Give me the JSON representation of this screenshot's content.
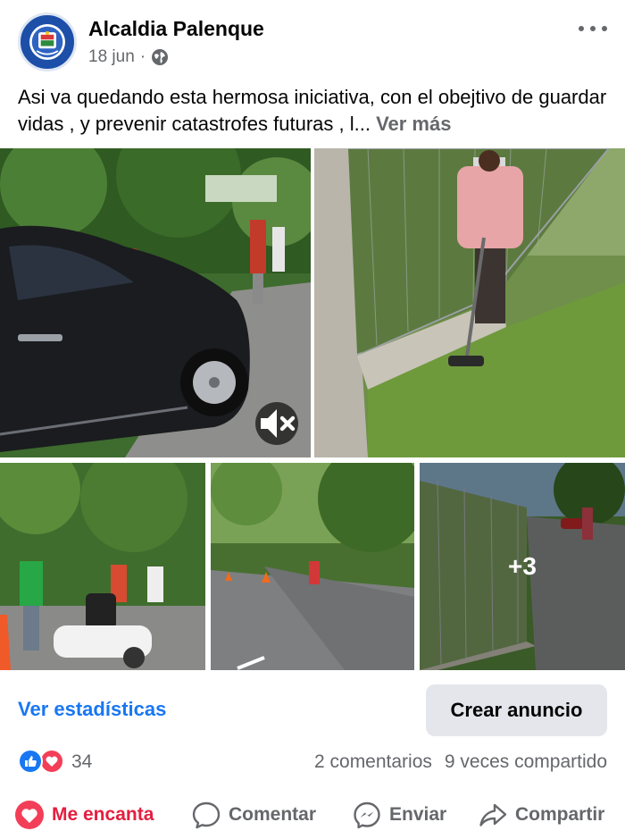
{
  "post": {
    "page_name": "Alcaldia Palenque",
    "date": "18 jun",
    "separator": "·",
    "text": "Asi va quedando esta hermosa iniciativa, con el obejtivo de guardar vidas , y prevenir catastrofes futuras , l...",
    "see_more": "Ver más"
  },
  "photos": {
    "more_count": "+3",
    "video_sound": "muted"
  },
  "footer": {
    "stats_link": "Ver estadísticas",
    "create_ad": "Crear anuncio"
  },
  "reactions": {
    "count": "34",
    "comments": "2 comentarios",
    "shares": "9 veces compartido"
  },
  "actions": {
    "love": "Me encanta",
    "comment": "Comentar",
    "send": "Enviar",
    "share": "Compartir"
  },
  "colors": {
    "brand_blue": "#1877f2",
    "love_red": "#e41e3f",
    "muted_text": "#65676b"
  },
  "icons": [
    "page-logo-icon",
    "globe-icon",
    "more-options-icon",
    "mute-icon",
    "like-reaction-icon",
    "love-reaction-icon",
    "heart-icon",
    "comment-icon",
    "messenger-icon",
    "share-icon"
  ]
}
